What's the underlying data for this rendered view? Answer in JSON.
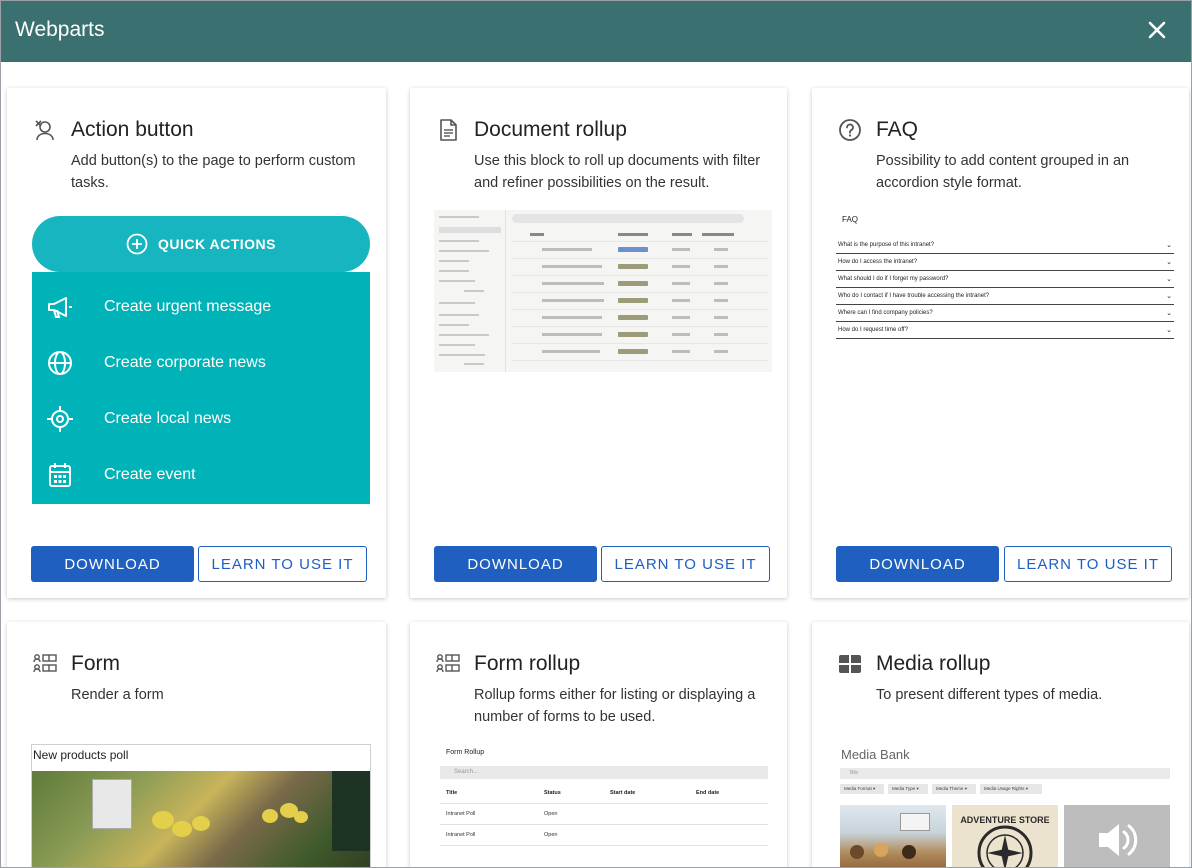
{
  "window": {
    "title": "Webparts",
    "close_icon": "close-icon"
  },
  "colors": {
    "header": "#3b7070",
    "primary_button": "#1e5fbf",
    "quick_actions": "#17b5bf"
  },
  "common": {
    "download": "DOWNLOAD",
    "learn": "LEARN TO USE IT"
  },
  "cards": [
    {
      "icon": "person-pin-icon",
      "name": "Action button",
      "description": "Add button(s) to the page to perform custom tasks.",
      "preview": {
        "pill_label": "QUICK ACTIONS",
        "items": [
          {
            "icon": "megaphone-icon",
            "label": "Create urgent message"
          },
          {
            "icon": "globe-icon",
            "label": "Create corporate news"
          },
          {
            "icon": "target-icon",
            "label": "Create local news"
          },
          {
            "icon": "calendar-icon",
            "label": "Create event"
          }
        ]
      }
    },
    {
      "icon": "document-icon",
      "name": "Document rollup",
      "description": "Use this block to roll up documents with filter and refiner possibilities on the result."
    },
    {
      "icon": "question-circle-icon",
      "name": "FAQ",
      "description": "Possibility to add content grouped in an accordion style format.",
      "preview": {
        "title": "FAQ",
        "questions": [
          "What is the purpose of this intranet?",
          "How do I access the intranet?",
          "What should I do if I forget my password?",
          "Who do I contact if I have trouble accessing the intranet?",
          "Where can I find company policies?",
          "How do I request time off?"
        ]
      }
    },
    {
      "icon": "form-list-icon",
      "name": "Form",
      "description": "Render a form",
      "preview": {
        "title": "New products poll"
      }
    },
    {
      "icon": "form-list-icon",
      "name": "Form rollup",
      "description": "Rollup forms either for listing or displaying a number of forms to be used.",
      "preview": {
        "title": "Form Rollup",
        "search": "Search...",
        "columns": [
          "Title",
          "Status",
          "Start date",
          "End date"
        ],
        "rows": [
          [
            "Intranet Poll",
            "Open"
          ],
          [
            "Intranet Poll",
            "Open"
          ]
        ]
      }
    },
    {
      "icon": "grid-icon",
      "name": "Media rollup",
      "description": "To present different types of media.",
      "preview": {
        "title": "Media Bank",
        "search": "Bilo",
        "filters": [
          "Media Format",
          "Media Type",
          "Media Theme",
          "Media Usage Rights"
        ],
        "store_text": "ADVENTURE STORE"
      }
    }
  ]
}
